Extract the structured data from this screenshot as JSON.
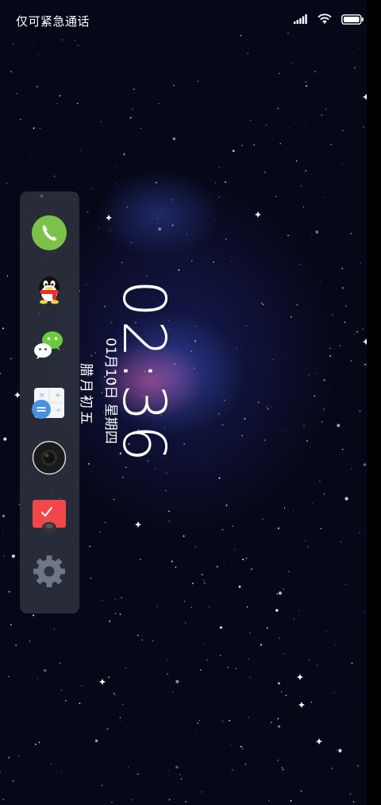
{
  "status_bar": {
    "carrier_text": "仅可紧急通话",
    "icons": [
      "signal-bars-icon",
      "wifi-icon",
      "battery-icon"
    ]
  },
  "lockscreen": {
    "time": "02:36",
    "date": "01月10日 星期四",
    "lunar_date": "腊月初五"
  },
  "dock": {
    "apps": [
      {
        "name": "phone-app-icon",
        "color": "#7cc24a"
      },
      {
        "name": "qq-app-icon",
        "color": "#ffd23c"
      },
      {
        "name": "wechat-app-icon",
        "color": "#6acb3c"
      },
      {
        "name": "calculator-app-icon",
        "color": "#4a90e2"
      },
      {
        "name": "camera-app-icon",
        "color": "#1a1a1a"
      },
      {
        "name": "music-app-icon",
        "color": "#f04848"
      },
      {
        "name": "settings-app-icon",
        "color": "#6e7788"
      }
    ]
  }
}
